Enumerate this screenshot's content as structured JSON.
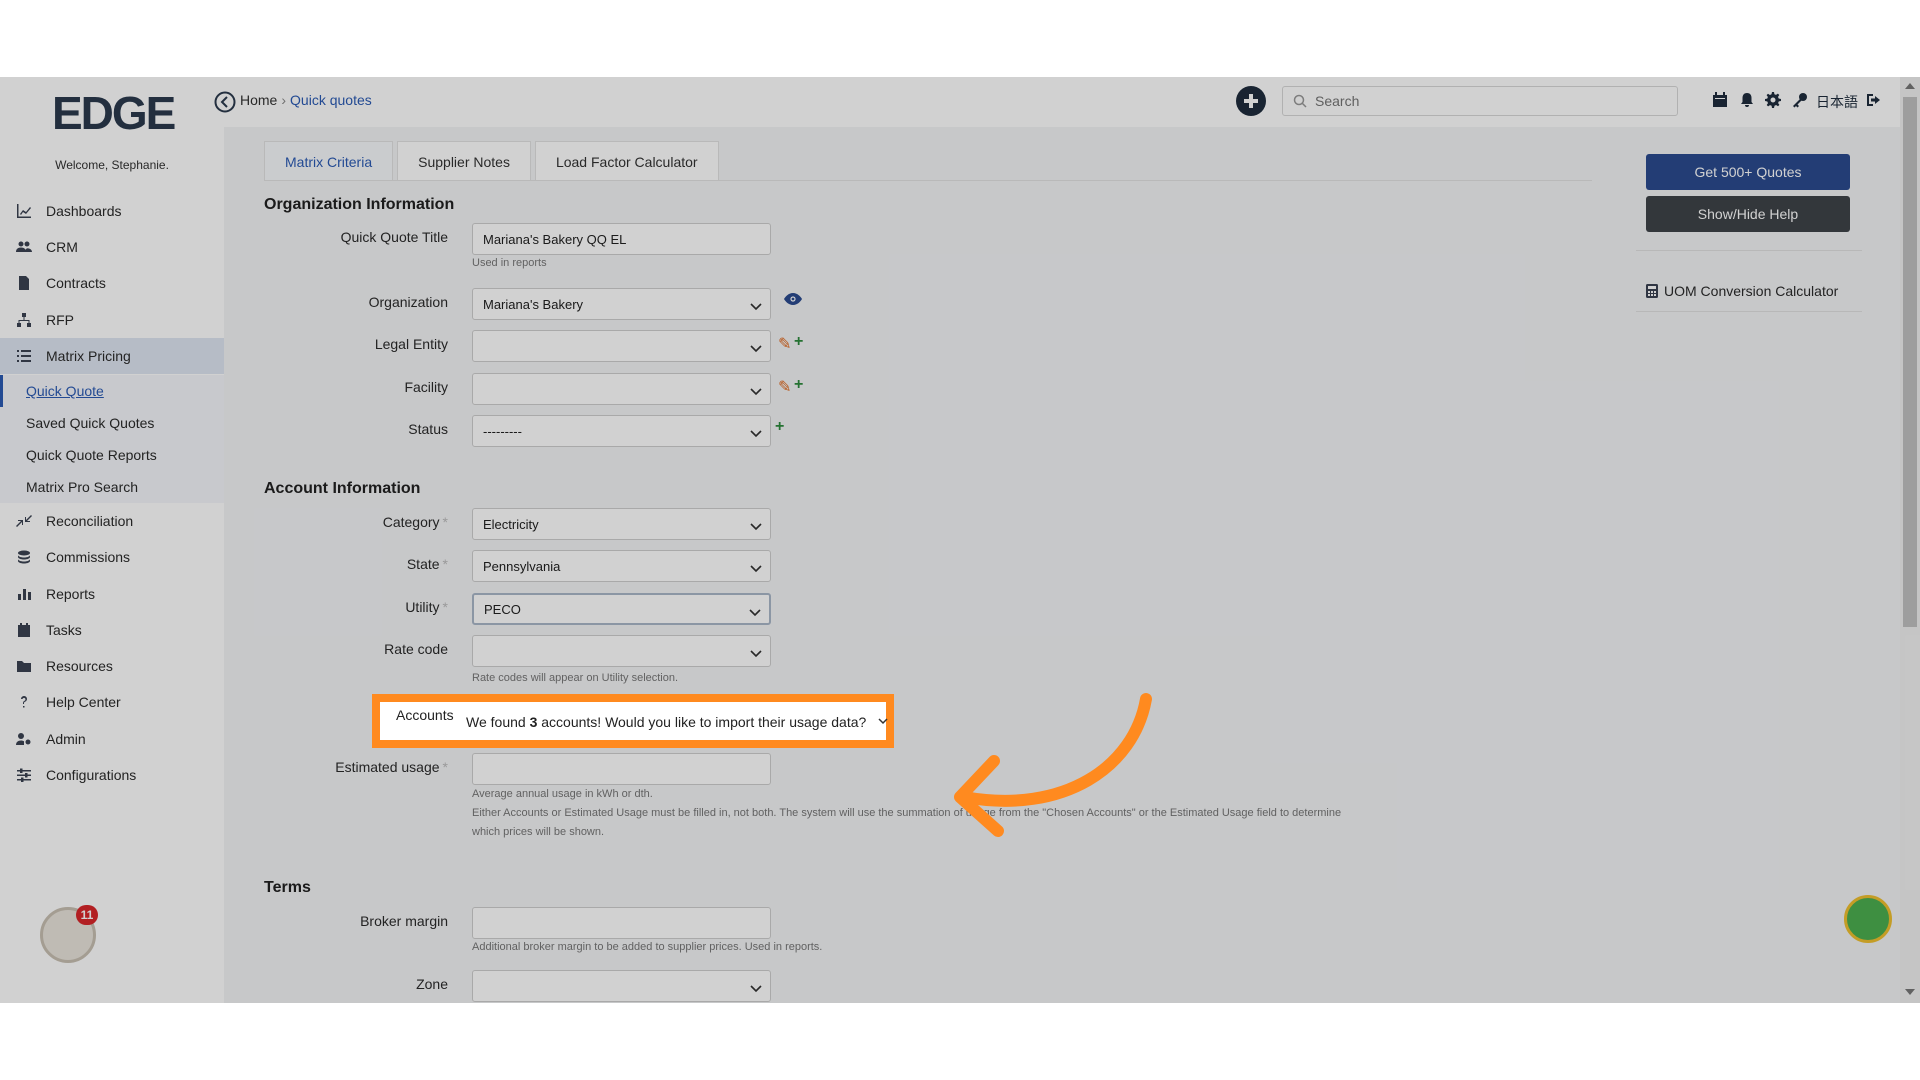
{
  "sidebar": {
    "logo_text": "EDGE",
    "welcome": "Welcome, Stephanie.",
    "items": [
      {
        "label": "Dashboards",
        "icon": "chart-line-icon"
      },
      {
        "label": "CRM",
        "icon": "users-icon"
      },
      {
        "label": "Contracts",
        "icon": "file-contract-icon"
      },
      {
        "label": "RFP",
        "icon": "sitemap-icon"
      },
      {
        "label": "Matrix Pricing",
        "icon": "list-icon"
      },
      {
        "label": "Reconciliation",
        "icon": "compress-icon"
      },
      {
        "label": "Commissions",
        "icon": "coins-icon"
      },
      {
        "label": "Reports",
        "icon": "bar-chart-icon"
      },
      {
        "label": "Tasks",
        "icon": "calendar-check-icon"
      },
      {
        "label": "Resources",
        "icon": "folder-icon"
      },
      {
        "label": "Help Center",
        "icon": "question-icon"
      },
      {
        "label": "Admin",
        "icon": "user-cog-icon"
      },
      {
        "label": "Configurations",
        "icon": "sliders-icon"
      }
    ],
    "subitems": [
      "Quick Quote",
      "Saved Quick Quotes",
      "Quick Quote Reports",
      "Matrix Pro Search"
    ],
    "badge_count": "11"
  },
  "header": {
    "breadcrumb_home": "Home",
    "breadcrumb_sep": "›",
    "breadcrumb_current": "Quick quotes",
    "search_placeholder": "Search",
    "language": "日本語"
  },
  "tabs": [
    "Matrix Criteria",
    "Supplier Notes",
    "Load Factor Calculator"
  ],
  "org": {
    "section": "Organization Information",
    "quick_quote_title_label": "Quick Quote Title",
    "quick_quote_title_value": "Mariana's Bakery QQ EL",
    "quick_quote_title_help": "Used in reports",
    "organization_label": "Organization",
    "organization_value": "Mariana's Bakery",
    "legal_entity_label": "Legal Entity",
    "legal_entity_value": "",
    "facility_label": "Facility",
    "facility_value": "",
    "status_label": "Status",
    "status_value": "---------"
  },
  "account": {
    "section": "Account Information",
    "category_label": "Category",
    "category_value": "Electricity",
    "state_label": "State",
    "state_value": "Pennsylvania",
    "utility_label": "Utility",
    "utility_value": "PECO",
    "rate_code_label": "Rate code",
    "rate_code_value": "",
    "rate_code_help": "Rate codes will appear on Utility selection.",
    "accounts_label": "Accounts",
    "accounts_msg_prefix": "We found ",
    "accounts_count": "3",
    "accounts_msg_suffix": " accounts! Would you like to import their usage data?",
    "estimated_usage_label": "Estimated usage",
    "estimated_usage_value": "",
    "estimated_usage_help1": "Average annual usage in kWh or dth.",
    "estimated_usage_help2": "Either Accounts or Estimated Usage must be filled in, not both. The system will use the summation of usage from the \"Chosen Accounts\" or the Estimated Usage field to determine",
    "estimated_usage_help3": "which prices will be shown."
  },
  "terms": {
    "section": "Terms",
    "broker_margin_label": "Broker margin",
    "broker_margin_value": "",
    "broker_margin_help": "Additional broker margin to be added to supplier prices. Used in reports.",
    "zone_label": "Zone",
    "zone_value": ""
  },
  "right_panel": {
    "get_quotes": "Get 500+ Quotes",
    "show_hide_help": "Show/Hide Help",
    "uom_calculator": "UOM Conversion Calculator"
  },
  "colors": {
    "primary": "#2b4b8f",
    "link": "#2b5bb4",
    "highlight": "#ff8a1f",
    "required_marker": "#bbbbbb",
    "add_green": "#2e8b3e",
    "edit_orange": "#e06a1f"
  }
}
